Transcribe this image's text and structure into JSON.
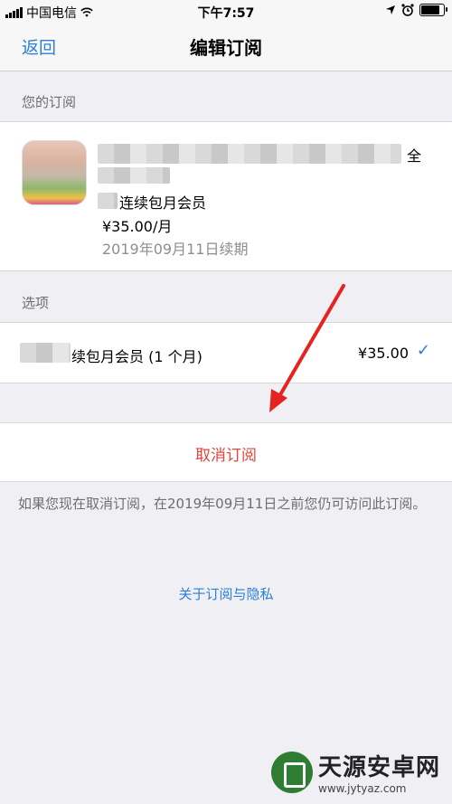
{
  "status": {
    "carrier": "中国电信",
    "time": "下午7:57",
    "battery_level": 0.85
  },
  "nav": {
    "back_label": "返回",
    "title": "编辑订阅"
  },
  "subscription": {
    "section_title": "您的订阅",
    "name_tail": "全",
    "plan": "连续包月会员",
    "price": "¥35.00/月",
    "renewal": "2019年09月11日续期"
  },
  "options": {
    "section_title": "选项",
    "item_label": "续包月会员 (1 个月)",
    "item_price": "¥35.00",
    "selected": true
  },
  "cancel": {
    "label": "取消订阅"
  },
  "note": "如果您现在取消订阅，在2019年09月11日之前您仍可访问此订阅。",
  "privacy_link": "关于订阅与隐私",
  "watermark": {
    "title": "天源安卓网",
    "url": "www.jytyaz.com"
  },
  "colors": {
    "accent": "#2b7fd6",
    "destructive": "#e0443a",
    "annotation_arrow": "#e52421"
  }
}
